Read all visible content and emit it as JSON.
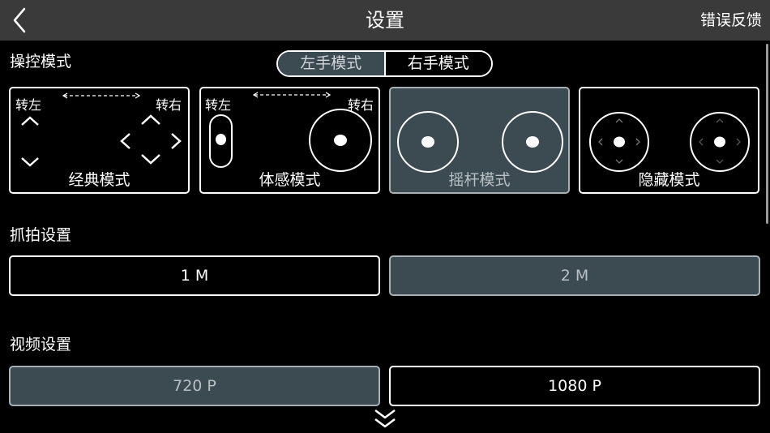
{
  "header": {
    "title": "设置",
    "feedback_label": "错误反馈"
  },
  "control_section": {
    "label": "操控模式",
    "hand_toggle": {
      "left_label": "左手模式",
      "right_label": "右手模式",
      "selected": "左手模式"
    },
    "modes": [
      {
        "label": "经典模式",
        "turn_left": "转左",
        "turn_right": "转右",
        "selected": false
      },
      {
        "label": "体感模式",
        "turn_left": "转左",
        "turn_right": "转右",
        "selected": false
      },
      {
        "label": "摇杆模式",
        "selected": true
      },
      {
        "label": "隐藏模式",
        "selected": false
      }
    ]
  },
  "capture_section": {
    "label": "抓拍设置",
    "options": [
      "1 M",
      "2 M"
    ],
    "selected": "2 M"
  },
  "video_section": {
    "label": "视频设置",
    "options": [
      "720 P",
      "1080 P"
    ],
    "selected": "720 P"
  },
  "colors": {
    "topbar": "#3a3a3a",
    "selected_fill": "#3c4a52",
    "background": "#000000"
  }
}
